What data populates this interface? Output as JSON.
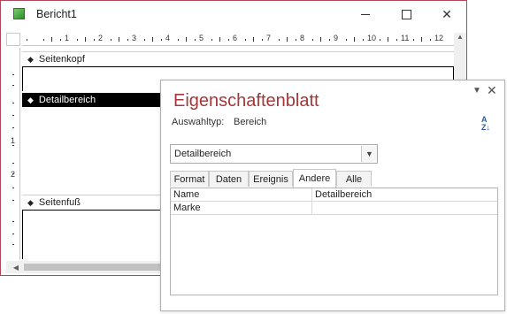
{
  "report_window": {
    "title": "Bericht1",
    "ruler_numbers": [
      "1",
      "2",
      "3",
      "4",
      "5",
      "6",
      "7",
      "8",
      "9",
      "10",
      "11",
      "12"
    ],
    "vertical_ruler_numbers": [
      "1",
      "2"
    ],
    "sections": {
      "header": "Seitenkopf",
      "detail": "Detailbereich",
      "footer": "Seitenfuß"
    }
  },
  "property_sheet": {
    "title": "Eigenschaftenblatt",
    "selection_type_label": "Auswahltyp:",
    "selection_type_value": "Bereich",
    "combo_value": "Detailbereich",
    "tabs": [
      "Format",
      "Daten",
      "Ereignis",
      "Andere",
      "Alle"
    ],
    "active_tab": "Andere",
    "rows": [
      {
        "name": "Name",
        "value": "Detailbereich"
      },
      {
        "name": "Marke",
        "value": ""
      }
    ]
  },
  "colors": {
    "title_accent": "#a4373a",
    "window_border": "#b0465a",
    "selected_section": "#000000"
  }
}
